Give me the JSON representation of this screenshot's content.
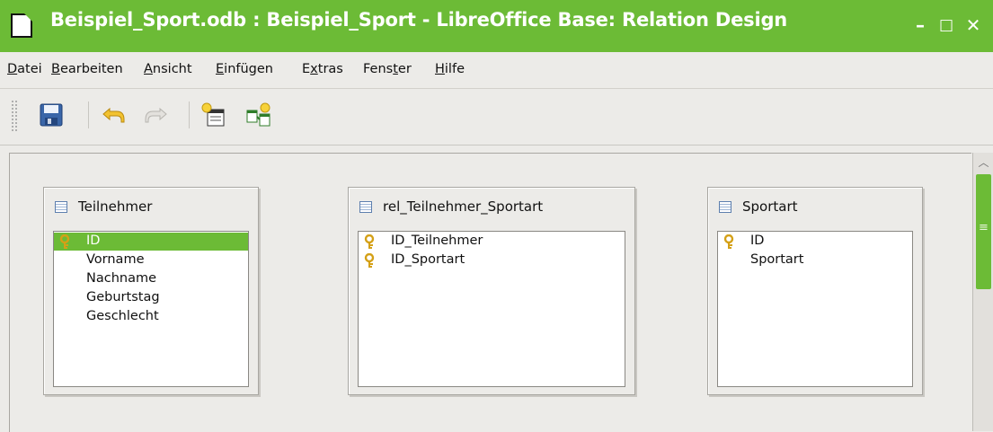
{
  "window": {
    "title": "Beispiel_Sport.odb : Beispiel_Sport - LibreOffice Base: Relation Design",
    "controls": {
      "minimize": "–",
      "maximize": "□",
      "close": "✕"
    }
  },
  "menu": {
    "items": [
      {
        "mnemonic": "D",
        "rest": "atei"
      },
      {
        "mnemonic": "B",
        "rest": "earbeiten"
      },
      {
        "mnemonic": "A",
        "rest": "nsicht"
      },
      {
        "mnemonic": "E",
        "rest": "infügen"
      },
      {
        "pre": "E",
        "mnemonic": "x",
        "rest": "tras"
      },
      {
        "pre": "Fens",
        "mnemonic": "t",
        "rest": "er"
      },
      {
        "mnemonic": "H",
        "rest": "ilfe"
      }
    ]
  },
  "toolbar": {
    "buttons": [
      "save-icon",
      "undo-icon",
      "redo-icon",
      "add-tables-icon",
      "new-relation-icon"
    ]
  },
  "tables": [
    {
      "name": "Teilnehmer",
      "fields": [
        {
          "name": "ID",
          "primary_key": true,
          "selected": true
        },
        {
          "name": "Vorname"
        },
        {
          "name": "Nachname"
        },
        {
          "name": "Geburtstag"
        },
        {
          "name": "Geschlecht"
        }
      ]
    },
    {
      "name": "rel_Teilnehmer_Sportart",
      "fields": [
        {
          "name": "ID_Teilnehmer",
          "primary_key": true
        },
        {
          "name": "ID_Sportart",
          "primary_key": true
        }
      ]
    },
    {
      "name": "Sportart",
      "fields": [
        {
          "name": "ID",
          "primary_key": true
        },
        {
          "name": "Sportart"
        }
      ]
    }
  ],
  "colors": {
    "accent": "#6cbb36",
    "key": "#d4a017",
    "background": "#ecebe8"
  }
}
